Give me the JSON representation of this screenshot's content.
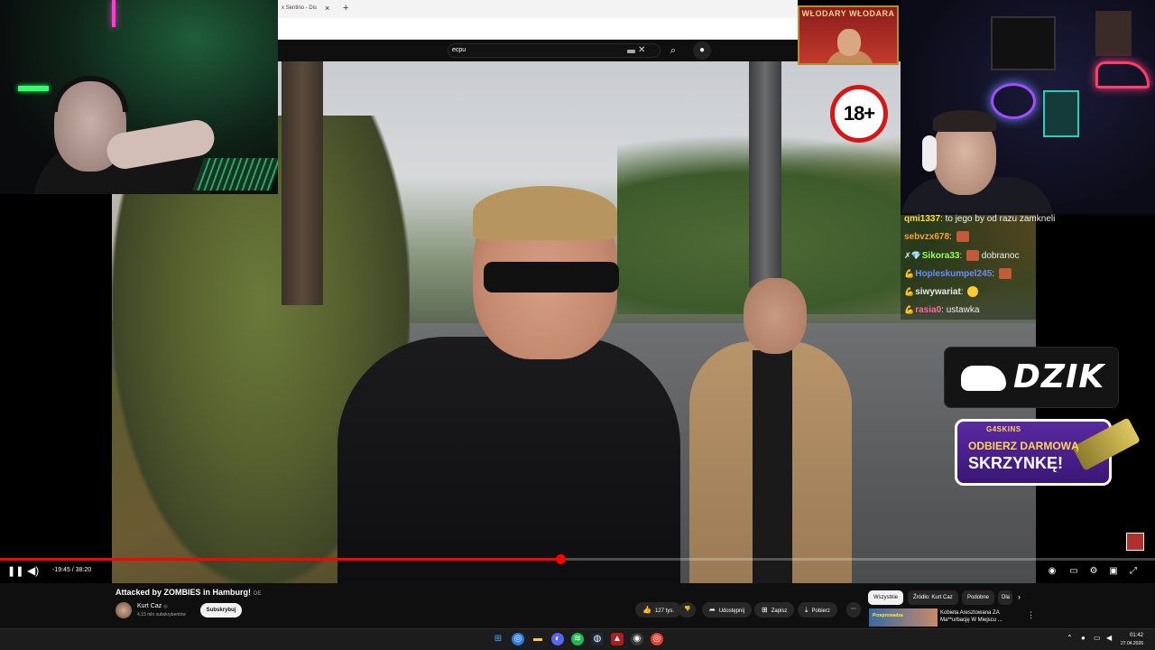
{
  "browser": {
    "tab_title": "x Sentino - Dis",
    "new_tab": "+",
    "tab_close": "×"
  },
  "search": {
    "query": "ecpu",
    "clear": "✕",
    "search_icon": "search-icon",
    "mic_icon": "mic-icon"
  },
  "overlays": {
    "wlodary": "WŁODARY WŁODARA",
    "age_rating": "18+",
    "dzik": "DZIK",
    "skins_brand": "G4SKINS",
    "skins_line1": "ODBIERZ DARMOWĄ",
    "skins_line2": "SKRZYNKĘ!"
  },
  "chat": {
    "messages": [
      {
        "user": "qmi1337",
        "user_color": "#ffd93a",
        "text": "to jego by od razu zamkneli",
        "emote": false,
        "badges": ""
      },
      {
        "user": "sebvzx678",
        "user_color": "#ff9f3a",
        "text": "",
        "emote": true,
        "badges": ""
      },
      {
        "user": "Sikora33",
        "user_color": "#9bff5a",
        "text": "dobranoc",
        "emote": true,
        "badges": "✗💎"
      },
      {
        "user": "Hopleskumpel245",
        "user_color": "#6a8bff",
        "text": "",
        "emote": true,
        "badges": "💪"
      },
      {
        "user": "siwywariat",
        "user_color": "#e8e8e8",
        "text": "",
        "emote": true,
        "badges": "💪"
      },
      {
        "user": "rasia0",
        "user_color": "#ff6aa8",
        "text": "ustawka",
        "emote": false,
        "badges": "💪"
      }
    ]
  },
  "player": {
    "time": "-19:45 / 38:20",
    "progress": 0.485,
    "accent": "#ff0000"
  },
  "video": {
    "title": "Attacked by ZOMBIES in Hamburg!",
    "lang": "DE",
    "channel": "Kurt Caz",
    "verified": "◎",
    "subscribers": "4,15 mln subskrybentów",
    "subscribe": "Subskrybuj",
    "likes": "127 tys.",
    "share": "Udostępnij",
    "save": "Zapisz",
    "download": "Pobierz",
    "more": "⋯"
  },
  "chips": [
    "Wszystkie",
    "Źródło: Kurt Caz",
    "Podobne",
    "Dla"
  ],
  "recommendation": {
    "thumb_label": "Przeprowadza",
    "title": "Kobieta Aresztowana ZA Ma**urbację W Miejscu ..."
  },
  "clock": {
    "time": "01:42",
    "date": "27.04.2026"
  }
}
